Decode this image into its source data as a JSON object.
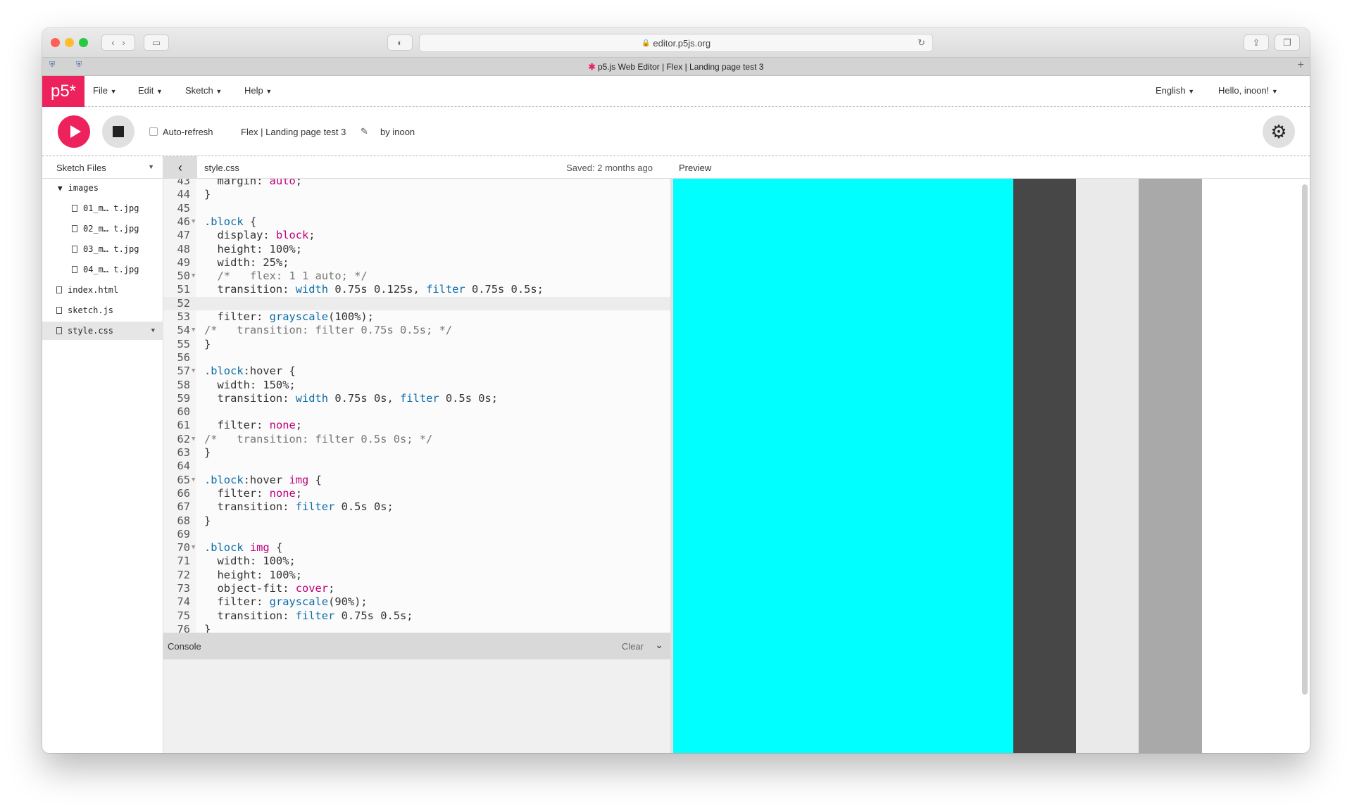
{
  "browser": {
    "url": "editor.p5js.org",
    "tab_title": "p5.js Web Editor | Flex | Landing page test 3"
  },
  "nav": {
    "logo": "p5*",
    "menus": [
      "File",
      "Edit",
      "Sketch",
      "Help"
    ],
    "language": "English",
    "user": "Hello, inoon!"
  },
  "toolbar": {
    "auto_refresh_label": "Auto-refresh",
    "sketch_name": "Flex | Landing page test 3",
    "author": "by inoon"
  },
  "files": {
    "header": "Sketch Files",
    "folder": "images",
    "items": [
      "01_m… t.jpg",
      "02_m… t.jpg",
      "03_m… t.jpg",
      "04_m… t.jpg",
      "index.html",
      "sketch.js",
      "style.css"
    ]
  },
  "editor": {
    "filename": "style.css",
    "saved": "Saved: 2 months ago",
    "lines": [
      {
        "n": "43",
        "fold": "",
        "segs": [
          {
            "t": "  margin: ",
            "c": ""
          },
          {
            "t": "auto",
            "c": "k"
          },
          {
            "t": ";",
            "c": ""
          }
        ]
      },
      {
        "n": "44",
        "fold": "",
        "segs": [
          {
            "t": "}",
            "c": ""
          }
        ]
      },
      {
        "n": "45",
        "fold": "",
        "segs": []
      },
      {
        "n": "46",
        "fold": "▼",
        "segs": [
          {
            "t": ".block",
            "c": "b"
          },
          {
            "t": " {",
            "c": ""
          }
        ]
      },
      {
        "n": "47",
        "fold": "",
        "segs": [
          {
            "t": "  display: ",
            "c": ""
          },
          {
            "t": "block",
            "c": "k"
          },
          {
            "t": ";",
            "c": ""
          }
        ]
      },
      {
        "n": "48",
        "fold": "",
        "segs": [
          {
            "t": "  height: 100%;",
            "c": ""
          }
        ]
      },
      {
        "n": "49",
        "fold": "",
        "segs": [
          {
            "t": "  width: 25%;",
            "c": ""
          }
        ]
      },
      {
        "n": "50",
        "fold": "▼",
        "segs": [
          {
            "t": "  /*   flex: 1 1 auto; */",
            "c": "c"
          }
        ]
      },
      {
        "n": "51",
        "fold": "",
        "segs": [
          {
            "t": "  transition: ",
            "c": ""
          },
          {
            "t": "width",
            "c": "b"
          },
          {
            "t": " 0.75s 0.125s, ",
            "c": ""
          },
          {
            "t": "filter",
            "c": "b"
          },
          {
            "t": " 0.75s 0.5s;",
            "c": ""
          }
        ]
      },
      {
        "n": "52",
        "fold": "",
        "segs": [],
        "hl": true
      },
      {
        "n": "53",
        "fold": "",
        "segs": [
          {
            "t": "  filter: ",
            "c": ""
          },
          {
            "t": "grayscale",
            "c": "b"
          },
          {
            "t": "(100%);",
            "c": ""
          }
        ]
      },
      {
        "n": "54",
        "fold": "▼",
        "segs": [
          {
            "t": "/*   transition: filter 0.75s 0.5s; */",
            "c": "c"
          }
        ]
      },
      {
        "n": "55",
        "fold": "",
        "segs": [
          {
            "t": "}",
            "c": ""
          }
        ]
      },
      {
        "n": "56",
        "fold": "",
        "segs": []
      },
      {
        "n": "57",
        "fold": "▼",
        "segs": [
          {
            "t": ".block",
            "c": "b"
          },
          {
            "t": ":hover {",
            "c": ""
          }
        ]
      },
      {
        "n": "58",
        "fold": "",
        "segs": [
          {
            "t": "  width: 150%;",
            "c": ""
          }
        ]
      },
      {
        "n": "59",
        "fold": "",
        "segs": [
          {
            "t": "  transition: ",
            "c": ""
          },
          {
            "t": "width",
            "c": "b"
          },
          {
            "t": " 0.75s 0s, ",
            "c": ""
          },
          {
            "t": "filter",
            "c": "b"
          },
          {
            "t": " 0.5s 0s;",
            "c": ""
          }
        ]
      },
      {
        "n": "60",
        "fold": "",
        "segs": []
      },
      {
        "n": "61",
        "fold": "",
        "segs": [
          {
            "t": "  filter: ",
            "c": ""
          },
          {
            "t": "none",
            "c": "k"
          },
          {
            "t": ";",
            "c": ""
          }
        ]
      },
      {
        "n": "62",
        "fold": "▼",
        "segs": [
          {
            "t": "/*   transition: filter 0.5s 0s; */",
            "c": "c"
          }
        ]
      },
      {
        "n": "63",
        "fold": "",
        "segs": [
          {
            "t": "}",
            "c": ""
          }
        ]
      },
      {
        "n": "64",
        "fold": "",
        "segs": []
      },
      {
        "n": "65",
        "fold": "▼",
        "segs": [
          {
            "t": ".block",
            "c": "b"
          },
          {
            "t": ":hover ",
            "c": ""
          },
          {
            "t": "img",
            "c": "k"
          },
          {
            "t": " {",
            "c": ""
          }
        ]
      },
      {
        "n": "66",
        "fold": "",
        "segs": [
          {
            "t": "  filter: ",
            "c": ""
          },
          {
            "t": "none",
            "c": "k"
          },
          {
            "t": ";",
            "c": ""
          }
        ]
      },
      {
        "n": "67",
        "fold": "",
        "segs": [
          {
            "t": "  transition: ",
            "c": ""
          },
          {
            "t": "filter",
            "c": "b"
          },
          {
            "t": " 0.5s 0s;",
            "c": ""
          }
        ]
      },
      {
        "n": "68",
        "fold": "",
        "segs": [
          {
            "t": "}",
            "c": ""
          }
        ]
      },
      {
        "n": "69",
        "fold": "",
        "segs": []
      },
      {
        "n": "70",
        "fold": "▼",
        "segs": [
          {
            "t": ".block",
            "c": "b"
          },
          {
            "t": " ",
            "c": ""
          },
          {
            "t": "img",
            "c": "k"
          },
          {
            "t": " {",
            "c": ""
          }
        ]
      },
      {
        "n": "71",
        "fold": "",
        "segs": [
          {
            "t": "  width: 100%;",
            "c": ""
          }
        ]
      },
      {
        "n": "72",
        "fold": "",
        "segs": [
          {
            "t": "  height: 100%;",
            "c": ""
          }
        ]
      },
      {
        "n": "73",
        "fold": "",
        "segs": [
          {
            "t": "  object-fit: ",
            "c": ""
          },
          {
            "t": "cover",
            "c": "k"
          },
          {
            "t": ";",
            "c": ""
          }
        ]
      },
      {
        "n": "74",
        "fold": "",
        "segs": [
          {
            "t": "  filter: ",
            "c": ""
          },
          {
            "t": "grayscale",
            "c": "b"
          },
          {
            "t": "(90%);",
            "c": ""
          }
        ]
      },
      {
        "n": "75",
        "fold": "",
        "segs": [
          {
            "t": "  transition: ",
            "c": ""
          },
          {
            "t": "filter",
            "c": "b"
          },
          {
            "t": " 0.75s 0.5s;",
            "c": ""
          }
        ]
      },
      {
        "n": "76",
        "fold": "",
        "segs": [
          {
            "t": "}",
            "c": ""
          }
        ]
      }
    ]
  },
  "console": {
    "label": "Console",
    "clear": "Clear"
  },
  "preview": {
    "label": "Preview",
    "blocks": [
      {
        "color": "#00ffff",
        "share": 0.5405
      },
      {
        "color": "#474747",
        "share": 0.1
      },
      {
        "color": "#eaeaea",
        "share": 0.1
      },
      {
        "color": "#a9a9a9",
        "share": 0.1
      }
    ]
  },
  "colors": {
    "accent": "#ed225d"
  }
}
